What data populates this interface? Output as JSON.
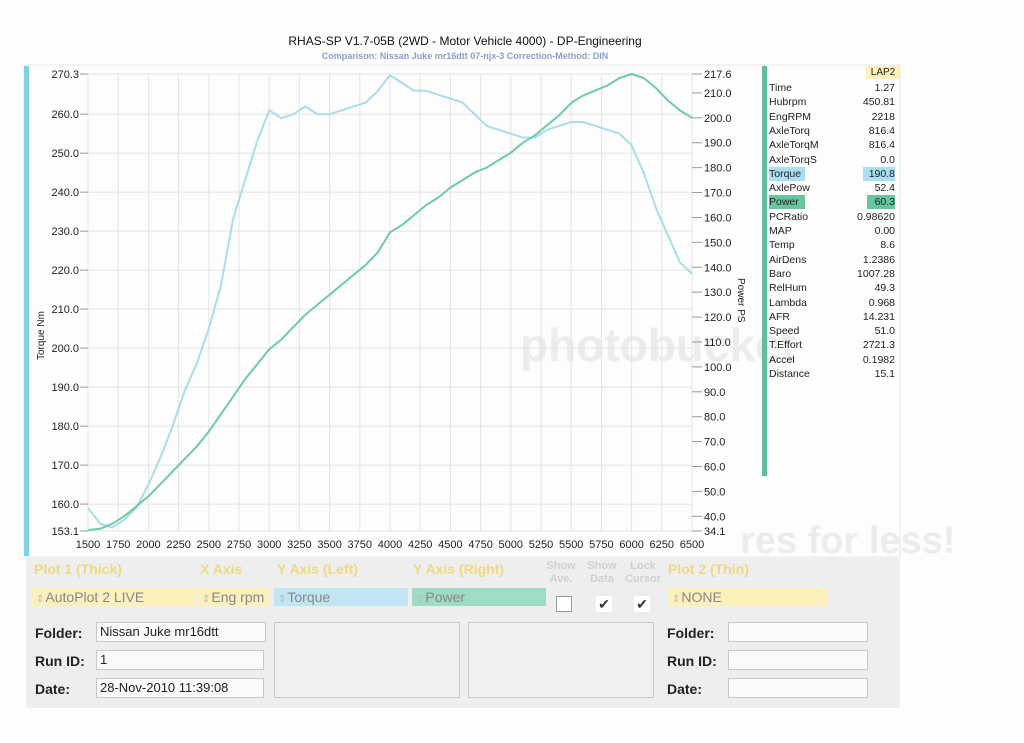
{
  "header": {
    "title": "RHAS-SP V1.7-05B   (2WD - Motor Vehicle 4000) - DP-Engineering",
    "subtitle": "Comparison: Nissan Juke mr16dtt 07-njx-3    Correction-Method: DIN"
  },
  "chart_data": {
    "type": "line",
    "xlabel": "",
    "ylabel_left": "Torque Nm",
    "ylabel_right": "Power PS",
    "x_ticks": [
      "1500",
      "1750",
      "2000",
      "2250",
      "2500",
      "2750",
      "3000",
      "3250",
      "3500",
      "3750",
      "4000",
      "4250",
      "4500",
      "4750",
      "5000",
      "5250",
      "5500",
      "5750",
      "6000",
      "6250",
      "6500"
    ],
    "left_ticks": [
      "270.3",
      "260.0",
      "250.0",
      "240.0",
      "230.0",
      "220.0",
      "210.0",
      "200.0",
      "190.0",
      "180.0",
      "170.0",
      "160.0",
      "153.1"
    ],
    "right_ticks": [
      "217.6",
      "210.0",
      "200.0",
      "190.0",
      "180.0",
      "170.0",
      "160.0",
      "150.0",
      "140.0",
      "130.0",
      "120.0",
      "110.0",
      "100.0",
      "90.0",
      "80.0",
      "70.0",
      "60.0",
      "50.0",
      "40.0",
      "34.1"
    ],
    "xlim": [
      1500,
      6500
    ],
    "ylim_left": [
      153.1,
      270.3
    ],
    "ylim_right": [
      34.1,
      217.6
    ],
    "grid": true,
    "series": [
      {
        "name": "Torque",
        "axis": "left",
        "color": "#a9dcec",
        "x": [
          1500,
          1600,
          1700,
          1800,
          1900,
          2000,
          2100,
          2200,
          2300,
          2400,
          2500,
          2600,
          2700,
          2800,
          2900,
          3000,
          3100,
          3200,
          3300,
          3400,
          3500,
          3600,
          3700,
          3800,
          3900,
          4000,
          4100,
          4200,
          4300,
          4400,
          4500,
          4600,
          4700,
          4800,
          4900,
          5000,
          5100,
          5200,
          5300,
          5400,
          5500,
          5600,
          5700,
          5800,
          5900,
          6000,
          6100,
          6200,
          6300,
          6400,
          6500
        ],
        "values": [
          159,
          155,
          154,
          156,
          159,
          165,
          172,
          180,
          189,
          196,
          205,
          216,
          233,
          243,
          253,
          261,
          259,
          260,
          262,
          260,
          260,
          261,
          262,
          263,
          266,
          270,
          268,
          266,
          266,
          265,
          264,
          263,
          260,
          257,
          256,
          255,
          254,
          254,
          256,
          257,
          258,
          258,
          257,
          256,
          255,
          252,
          245,
          236,
          229,
          222,
          219
        ]
      },
      {
        "name": "Power",
        "axis": "right",
        "color": "#6fcaa6",
        "x": [
          1500,
          1600,
          1700,
          1800,
          1900,
          2000,
          2100,
          2200,
          2300,
          2400,
          2500,
          2600,
          2700,
          2800,
          2900,
          3000,
          3100,
          3200,
          3300,
          3400,
          3500,
          3600,
          3700,
          3800,
          3900,
          4000,
          4100,
          4200,
          4300,
          4400,
          4500,
          4600,
          4700,
          4800,
          4900,
          5000,
          5100,
          5200,
          5300,
          5400,
          5500,
          5600,
          5700,
          5800,
          5900,
          6000,
          6100,
          6200,
          6300,
          6400,
          6500
        ],
        "values": [
          34.5,
          35,
          37,
          40,
          44,
          48,
          53,
          58,
          63,
          68,
          74,
          81,
          88,
          95,
          101,
          107,
          111,
          116,
          121,
          125,
          129,
          133,
          137,
          141,
          146,
          154,
          157,
          161,
          165,
          168,
          172,
          175,
          178,
          180,
          183,
          186,
          190,
          193,
          197,
          201,
          206,
          209,
          211,
          213,
          216,
          217.6,
          216,
          212,
          207,
          203,
          200
        ]
      }
    ],
    "y_axis_colors": {
      "left": "#7fd0e6",
      "right": "#5cc0a0"
    }
  },
  "side_panel": {
    "lap": "LAP2",
    "rows": [
      {
        "k": "Time",
        "v": "1.27"
      },
      {
        "k": "Hubrpm",
        "v": "450.81"
      },
      {
        "k": "EngRPM",
        "v": "2218"
      },
      {
        "k": "AxleTorq",
        "v": "816.4"
      },
      {
        "k": "AxleTorqM",
        "v": "816.4"
      },
      {
        "k": "AxleTorqS",
        "v": "0.0"
      },
      {
        "k": "Torque",
        "v": "190.8"
      },
      {
        "k": "AxlePow",
        "v": "52.4"
      },
      {
        "k": "Power",
        "v": "60.3"
      },
      {
        "k": "PCRatio",
        "v": "0.98620"
      },
      {
        "k": "MAP",
        "v": "0.00"
      },
      {
        "k": "Temp",
        "v": "8.6"
      },
      {
        "k": "AirDens",
        "v": "1.2386"
      },
      {
        "k": "Baro",
        "v": "1007.28"
      },
      {
        "k": "RelHum",
        "v": "49.3"
      },
      {
        "k": "Lambda",
        "v": "0.968"
      },
      {
        "k": "AFR",
        "v": "14.231"
      },
      {
        "k": "Speed",
        "v": "51.0"
      },
      {
        "k": "T.Effort",
        "v": "2721.3"
      },
      {
        "k": "Accel",
        "v": "0.1982"
      },
      {
        "k": "Distance",
        "v": "15.1"
      }
    ]
  },
  "controls": {
    "plot1_label": "Plot 1 (Thick)",
    "xaxis_label": "X Axis",
    "yleft_label": "Y Axis (Left)",
    "yright_label": "Y Axis (Right)",
    "show_ave_label": "Show Ave.",
    "show_data_label": "Show Data",
    "lock_cursor_label": "Lock Cursor",
    "plot2_label": "Plot 2 (Thin)",
    "plot1_value": "AutoPlot 2 LIVE",
    "xaxis_value": "Eng rpm",
    "yleft_value": "Torque",
    "yright_value": "Power",
    "plot2_value": "NONE",
    "show_ave_checked": "",
    "show_data_checked": "✔",
    "lock_cursor_checked": "✔",
    "colors": {
      "plot1": "#fbf0bb",
      "yleft": "#bfe6f2",
      "yright": "#9fdcc3",
      "plot2": "#fbf0bb"
    }
  },
  "run_info_left": {
    "folder_label": "Folder:",
    "folder_value": "Nissan Juke mr16dtt",
    "runid_label": "Run ID:",
    "runid_value": "1",
    "date_label": "Date:",
    "date_value": "28-Nov-2010  11:39:08"
  },
  "run_info_right": {
    "folder_label": "Folder:",
    "runid_label": "Run ID:",
    "date_label": "Date:"
  },
  "watermark": {
    "text1": "photobucket",
    "text2": "res for less!"
  }
}
